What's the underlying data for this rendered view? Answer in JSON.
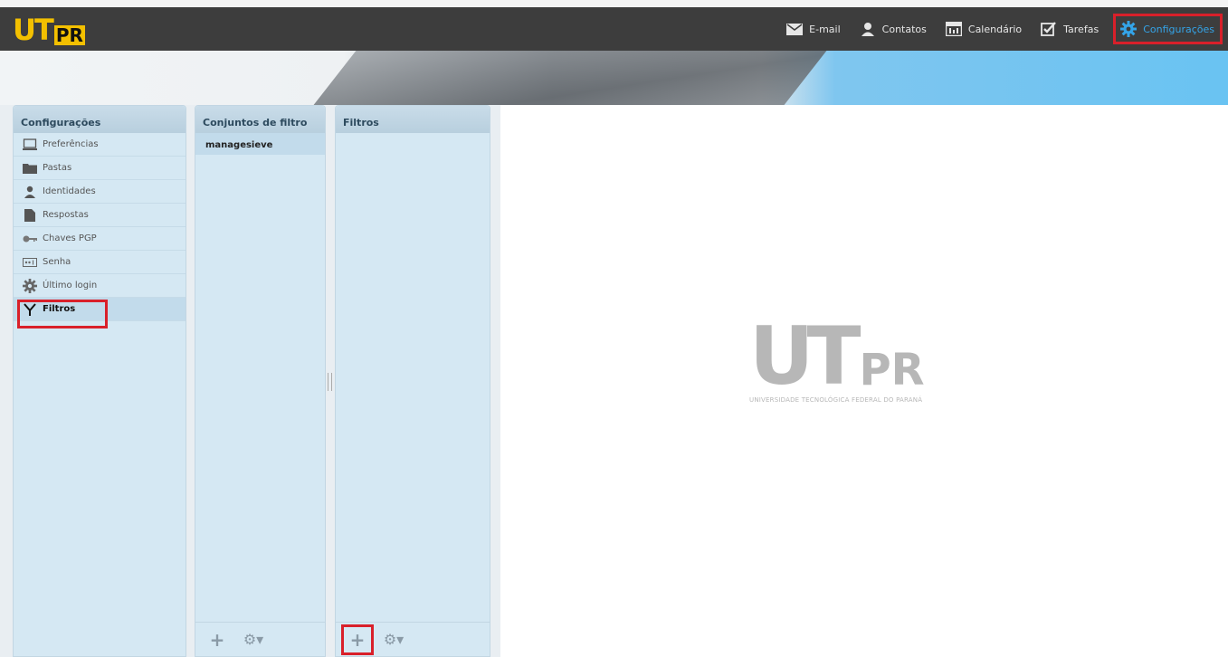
{
  "app": {
    "logo": {
      "mark_u": "U",
      "mark_t": "T",
      "mark_pr": "PR"
    }
  },
  "topnav": [
    {
      "label": "E-mail",
      "icon": "mail-icon"
    },
    {
      "label": "Contatos",
      "icon": "person-icon"
    },
    {
      "label": "Calendário",
      "icon": "calendar-icon"
    },
    {
      "label": "Tarefas",
      "icon": "checkbox-icon"
    },
    {
      "label": "Configurações",
      "icon": "gear-icon",
      "active": true
    }
  ],
  "settings_panel": {
    "title": "Configurações",
    "items": [
      {
        "label": "Preferências",
        "icon": "monitor-icon"
      },
      {
        "label": "Pastas",
        "icon": "folder-icon"
      },
      {
        "label": "Identidades",
        "icon": "person-icon"
      },
      {
        "label": "Respostas",
        "icon": "document-icon"
      },
      {
        "label": "Chaves PGP",
        "icon": "key-icon"
      },
      {
        "label": "Senha",
        "icon": "password-icon"
      },
      {
        "label": "Último login",
        "icon": "gear-icon"
      },
      {
        "label": "Filtros",
        "icon": "filter-icon",
        "selected": true
      }
    ]
  },
  "filtersets_panel": {
    "title": "Conjuntos de filtro",
    "items": [
      {
        "label": "managesieve"
      }
    ],
    "footer": {
      "add": "+",
      "gear": "⚙▾"
    }
  },
  "filters_panel": {
    "title": "Filtros",
    "footer": {
      "add": "+",
      "gear": "⚙▾"
    }
  },
  "content": {
    "logo_big": "UT",
    "logo_pr": "PR",
    "logo_subtitle": "UNIVERSIDADE TECNOLÓGICA FEDERAL DO PARANÁ"
  },
  "colors": {
    "accent": "#34a4e8",
    "highlight": "#d9202a",
    "logo_yellow": "#f3c000"
  }
}
